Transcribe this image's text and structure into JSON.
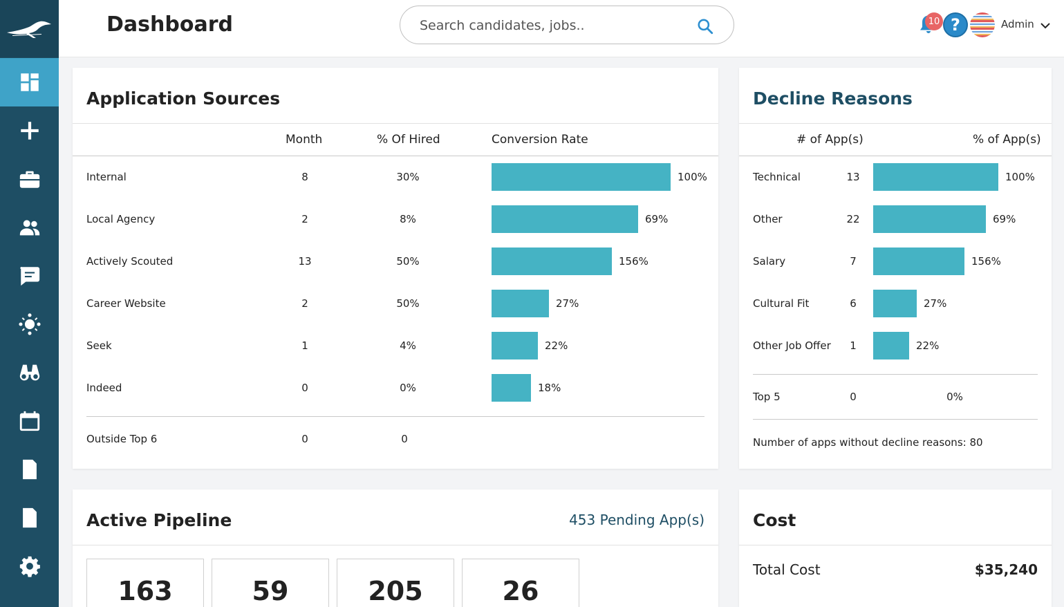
{
  "header": {
    "title": "Dashboard",
    "search_placeholder": "Search candidates, jobs..",
    "notification_count": "10",
    "help_label": "?",
    "user_name": "Admin"
  },
  "sidebar": {
    "items": [
      {
        "icon": "dashboard-icon",
        "active": true
      },
      {
        "icon": "add-icon"
      },
      {
        "icon": "briefcase-icon"
      },
      {
        "icon": "people-icon"
      },
      {
        "icon": "chat-icon"
      },
      {
        "icon": "network-icon"
      },
      {
        "icon": "binoculars-icon"
      },
      {
        "icon": "calendar-icon"
      },
      {
        "icon": "calculator-icon"
      },
      {
        "icon": "report-icon"
      },
      {
        "icon": "settings-icon"
      }
    ]
  },
  "app_sources": {
    "title": "Application Sources",
    "headers": {
      "month": "Month",
      "hired": "% Of Hired",
      "conversion": "Conversion Rate"
    },
    "rows": [
      {
        "name": "Internal",
        "month": "8",
        "hired": "30%",
        "rate_label": "100%",
        "rate_bar": 1.0
      },
      {
        "name": "Local Agency",
        "month": "2",
        "hired": "8%",
        "rate_label": "69%",
        "rate_bar": 0.82
      },
      {
        "name": "Actively Scouted",
        "month": "13",
        "hired": "50%",
        "rate_label": "156%",
        "rate_bar": 0.67
      },
      {
        "name": "Career Website",
        "month": "2",
        "hired": "50%",
        "rate_label": "27%",
        "rate_bar": 0.32
      },
      {
        "name": "Seek",
        "month": "1",
        "hired": "4%",
        "rate_label": "22%",
        "rate_bar": 0.26
      },
      {
        "name": "Indeed",
        "month": "0",
        "hired": "0%",
        "rate_label": "18%",
        "rate_bar": 0.22
      }
    ],
    "footer": {
      "name": "Outside Top 6",
      "month": "0",
      "hired": "0"
    }
  },
  "decline": {
    "title": "Decline Reasons",
    "headers": {
      "apps": "# of App(s)",
      "pct": "% of App(s)"
    },
    "rows": [
      {
        "name": "Technical",
        "apps": "13",
        "pct_label": "100%",
        "pct_bar": 1.0
      },
      {
        "name": "Other",
        "apps": "22",
        "pct_label": "69%",
        "pct_bar": 0.9
      },
      {
        "name": "Salary",
        "apps": "7",
        "pct_label": "156%",
        "pct_bar": 0.73
      },
      {
        "name": "Cultural Fit",
        "apps": "6",
        "pct_label": "27%",
        "pct_bar": 0.35
      },
      {
        "name": "Other Job Offer",
        "apps": "1",
        "pct_label": "22%",
        "pct_bar": 0.29
      }
    ],
    "top5": {
      "name": "Top 5",
      "apps": "0",
      "pct": "0%"
    },
    "note": "Number of apps without decline reasons: 80"
  },
  "pipeline": {
    "title": "Active Pipeline",
    "pending": "453 Pending App(s)",
    "stats": [
      "163",
      "59",
      "205",
      "26"
    ]
  },
  "cost": {
    "title": "Cost",
    "total_label": "Total Cost",
    "total_value": "$35,240"
  },
  "colors": {
    "sidebar": "#1e4e64",
    "sidebar_active": "#3fa3c8",
    "bar": "#45b3c4",
    "badge": "#e86565",
    "help": "#2b8ac9"
  }
}
